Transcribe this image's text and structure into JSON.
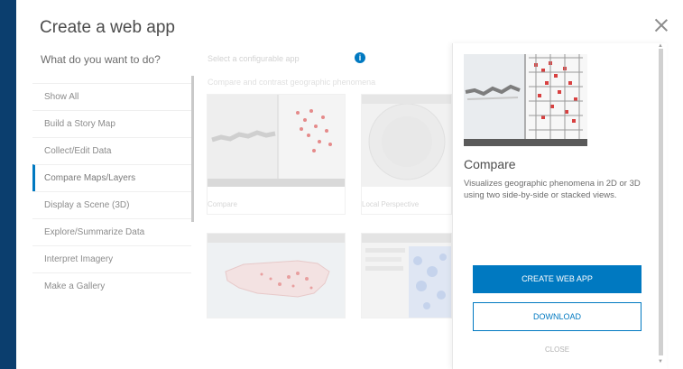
{
  "dialog": {
    "title": "Create a web app",
    "question": "What do you want to do?"
  },
  "nav": {
    "items": [
      {
        "label": "Show All"
      },
      {
        "label": "Build a Story Map"
      },
      {
        "label": "Collect/Edit Data"
      },
      {
        "label": "Compare Maps/Layers",
        "active": true
      },
      {
        "label": "Display a Scene (3D)"
      },
      {
        "label": "Explore/Summarize Data"
      },
      {
        "label": "Interpret Imagery"
      },
      {
        "label": "Make a Gallery"
      }
    ]
  },
  "gallery": {
    "header": "Select a configurable app",
    "info_icon": "info-icon",
    "subheader": "Compare and contrast geographic phenomena",
    "tiles": [
      {
        "label": "Compare"
      },
      {
        "label": "Local Perspective"
      },
      {
        "label": ""
      },
      {
        "label": ""
      }
    ]
  },
  "detail": {
    "title": "Compare",
    "description": "Visualizes geographic phenomena in 2D or 3D using two side-by-side or stacked views.",
    "create_label": "CREATE WEB APP",
    "download_label": "DOWNLOAD",
    "close_label": "CLOSE"
  },
  "colors": {
    "accent": "#0079c1",
    "background": "#0b3e6e"
  }
}
